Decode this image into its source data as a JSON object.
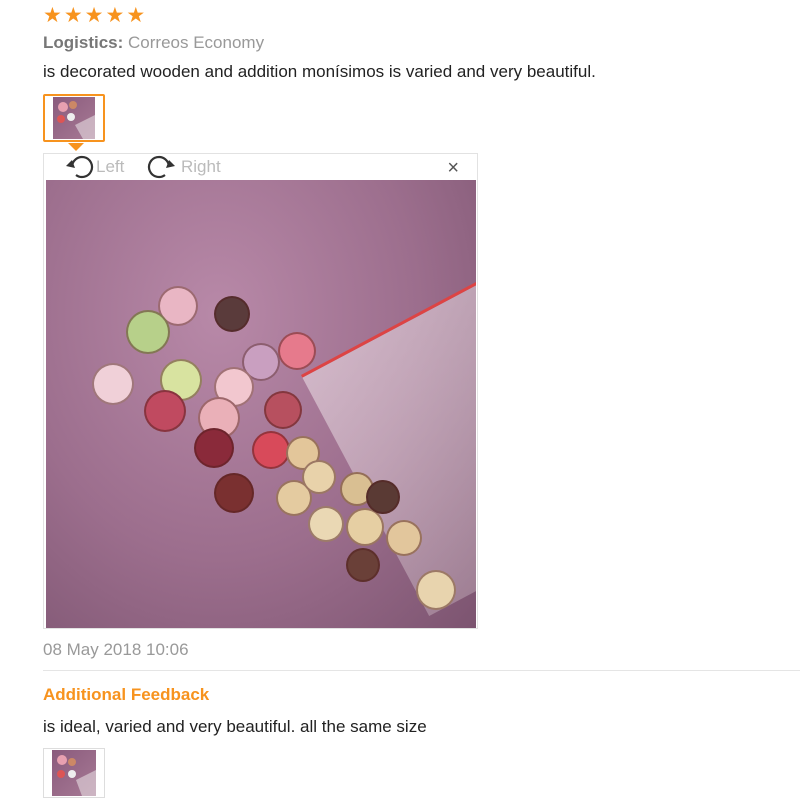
{
  "rating": {
    "stars": 5,
    "star_glyph": "★",
    "color": "#f7931e"
  },
  "logistics": {
    "label": "Logistics:",
    "value": "Correos Economy"
  },
  "review_text": "is decorated wooden and addition monísimos is varied and very beautiful.",
  "viewer": {
    "rotate_left": "Left",
    "rotate_right": "Right",
    "close_glyph": "×"
  },
  "date": "08 May 2018 10:06",
  "additional_feedback": {
    "title": "Additional Feedback",
    "text": "is ideal, varied and very beautiful. all the same size"
  },
  "colors": {
    "accent": "#f7931e",
    "muted": "#999999"
  }
}
